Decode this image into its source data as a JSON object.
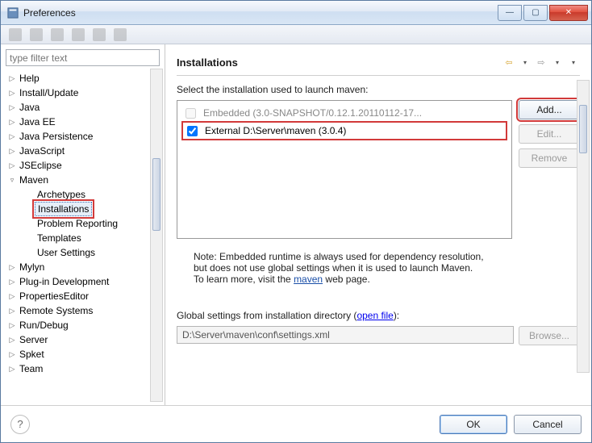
{
  "window_title": "Preferences",
  "filter_placeholder": "type filter text",
  "tree": [
    {
      "label": "Help",
      "level": 0,
      "expand": "▷"
    },
    {
      "label": "Install/Update",
      "level": 0,
      "expand": "▷"
    },
    {
      "label": "Java",
      "level": 0,
      "expand": "▷"
    },
    {
      "label": "Java EE",
      "level": 0,
      "expand": "▷"
    },
    {
      "label": "Java Persistence",
      "level": 0,
      "expand": "▷"
    },
    {
      "label": "JavaScript",
      "level": 0,
      "expand": "▷"
    },
    {
      "label": "JSEclipse",
      "level": 0,
      "expand": "▷"
    },
    {
      "label": "Maven",
      "level": 0,
      "expand": "▿"
    },
    {
      "label": "Archetypes",
      "level": 1,
      "expand": ""
    },
    {
      "label": "Installations",
      "level": 1,
      "expand": "",
      "selected": true,
      "highlighted": true
    },
    {
      "label": "Problem Reporting",
      "level": 1,
      "expand": ""
    },
    {
      "label": "Templates",
      "level": 1,
      "expand": ""
    },
    {
      "label": "User Settings",
      "level": 1,
      "expand": ""
    },
    {
      "label": "Mylyn",
      "level": 0,
      "expand": "▷"
    },
    {
      "label": "Plug-in Development",
      "level": 0,
      "expand": "▷"
    },
    {
      "label": "PropertiesEditor",
      "level": 0,
      "expand": "▷"
    },
    {
      "label": "Remote Systems",
      "level": 0,
      "expand": "▷"
    },
    {
      "label": "Run/Debug",
      "level": 0,
      "expand": "▷"
    },
    {
      "label": "Server",
      "level": 0,
      "expand": "▷"
    },
    {
      "label": "Spket",
      "level": 0,
      "expand": "▷"
    },
    {
      "label": "Team",
      "level": 0,
      "expand": "▷"
    }
  ],
  "section_title": "Installations",
  "select_label": "Select the installation used to launch maven:",
  "installs": [
    {
      "label": "Embedded (3.0-SNAPSHOT/0.12.1.20110112-17...",
      "checked": false,
      "disabled": true
    },
    {
      "label": "External D:\\Server\\maven (3.0.4)",
      "checked": true,
      "highlighted": true
    }
  ],
  "buttons": {
    "add": "Add...",
    "edit": "Edit...",
    "remove": "Remove",
    "browse": "Browse...",
    "ok": "OK",
    "cancel": "Cancel"
  },
  "note_line1": "Note: Embedded runtime is always used for dependency resolution,",
  "note_line2": "but does not use global settings when it is used to launch Maven.",
  "note_line3a": "To learn more, visit the ",
  "note_link": "maven",
  "note_line3b": " web page.",
  "global_label_a": "Global settings from installation directory (",
  "global_link": "open file",
  "global_label_b": "):",
  "global_path": "D:\\Server\\maven\\conf\\settings.xml"
}
